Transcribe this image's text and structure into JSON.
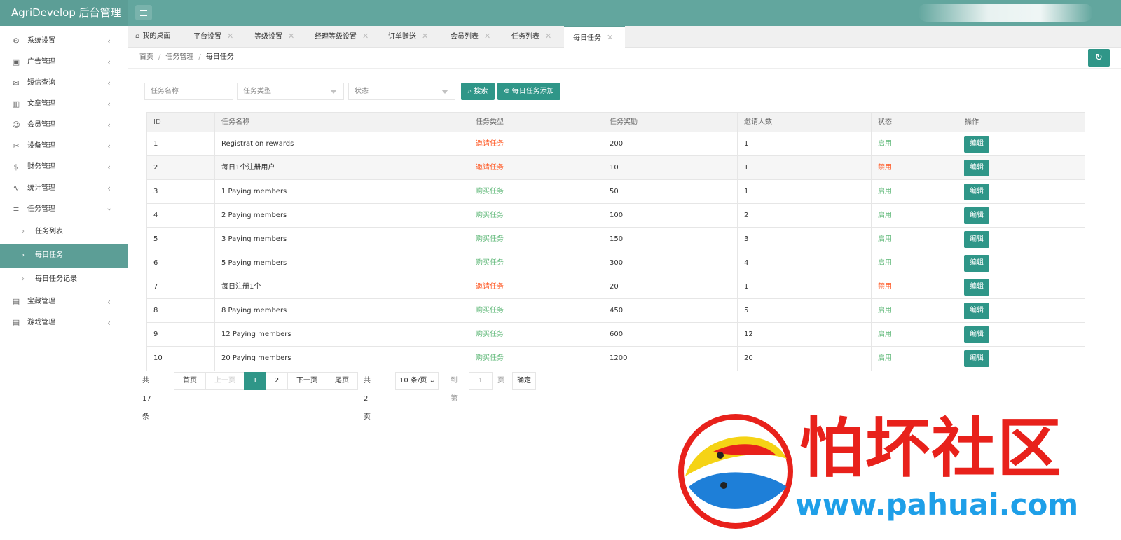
{
  "app": {
    "title": "AgriDevelop 后台管理"
  },
  "sidebar": {
    "items": [
      {
        "label": "系统设置",
        "icon": "gear-icon"
      },
      {
        "label": "广告管理",
        "icon": "image-icon"
      },
      {
        "label": "短信查询",
        "icon": "mail-icon"
      },
      {
        "label": "文章管理",
        "icon": "book-icon"
      },
      {
        "label": "会员管理",
        "icon": "user-icon"
      },
      {
        "label": "设备管理",
        "icon": "tool-icon"
      },
      {
        "label": "财务管理",
        "icon": "dollar-icon"
      },
      {
        "label": "统计管理",
        "icon": "chart-icon"
      },
      {
        "label": "任务管理",
        "icon": "sliders-icon"
      }
    ],
    "task_children": [
      {
        "label": "任务列表"
      },
      {
        "label": "每日任务"
      },
      {
        "label": "每日任务记录"
      }
    ],
    "tail_items": [
      {
        "label": "宝藏管理",
        "icon": "gift-icon"
      },
      {
        "label": "游戏管理",
        "icon": "gift-icon"
      }
    ]
  },
  "tabs": [
    {
      "label": "我的桌面"
    },
    {
      "label": "平台设置"
    },
    {
      "label": "等级设置"
    },
    {
      "label": "经理等级设置"
    },
    {
      "label": "订单赠送"
    },
    {
      "label": "会员列表"
    },
    {
      "label": "任务列表"
    },
    {
      "label": "每日任务"
    }
  ],
  "breadcrumb": {
    "home": "首页",
    "section": "任务管理",
    "current": "每日任务",
    "sep": "/"
  },
  "filters": {
    "name_placeholder": "任务名称",
    "type_placeholder": "任务类型",
    "status_placeholder": "状态",
    "search_label": "搜索",
    "add_label": "每日任务添加"
  },
  "table": {
    "headers": [
      "ID",
      "任务名称",
      "任务类型",
      "任务奖励",
      "邀请人数",
      "状态",
      "操作"
    ],
    "edit_label": "编辑",
    "rows": [
      {
        "id": "1",
        "name": "Registration rewards",
        "type": "邀请任务",
        "reward": "200",
        "invites": "1",
        "status": "启用"
      },
      {
        "id": "2",
        "name": "每日1个注册用户",
        "type": "邀请任务",
        "reward": "10",
        "invites": "1",
        "status": "禁用"
      },
      {
        "id": "3",
        "name": "1 Paying members",
        "type": "购买任务",
        "reward": "50",
        "invites": "1",
        "status": "启用"
      },
      {
        "id": "4",
        "name": "2 Paying members",
        "type": "购买任务",
        "reward": "100",
        "invites": "2",
        "status": "启用"
      },
      {
        "id": "5",
        "name": "3 Paying members",
        "type": "购买任务",
        "reward": "150",
        "invites": "3",
        "status": "启用"
      },
      {
        "id": "6",
        "name": "5 Paying members",
        "type": "购买任务",
        "reward": "300",
        "invites": "4",
        "status": "启用"
      },
      {
        "id": "7",
        "name": "每日注册1个",
        "type": "邀请任务",
        "reward": "20",
        "invites": "1",
        "status": "禁用"
      },
      {
        "id": "8",
        "name": "8 Paying members",
        "type": "购买任务",
        "reward": "450",
        "invites": "5",
        "status": "启用"
      },
      {
        "id": "9",
        "name": "12 Paying members",
        "type": "购买任务",
        "reward": "600",
        "invites": "12",
        "status": "启用"
      },
      {
        "id": "10",
        "name": "20 Paying members",
        "type": "购买任务",
        "reward": "1200",
        "invites": "20",
        "status": "启用"
      }
    ]
  },
  "pagination": {
    "total": "共 17 条",
    "first": "首页",
    "prev": "上一页",
    "page1": "1",
    "page2": "2",
    "next": "下一页",
    "last": "尾页",
    "pages": "共 2 页",
    "per_page": "10 条/页",
    "goto_label": "到第",
    "goto_value": "1",
    "page_unit": "页",
    "confirm": "确定"
  },
  "watermark": {
    "text": "怕坏社区",
    "url": "www.pahuai.com"
  },
  "colors": {
    "header": "#62a69e",
    "accent": "#2f9688",
    "invite": "#ff5722",
    "buy": "#5fb878"
  }
}
